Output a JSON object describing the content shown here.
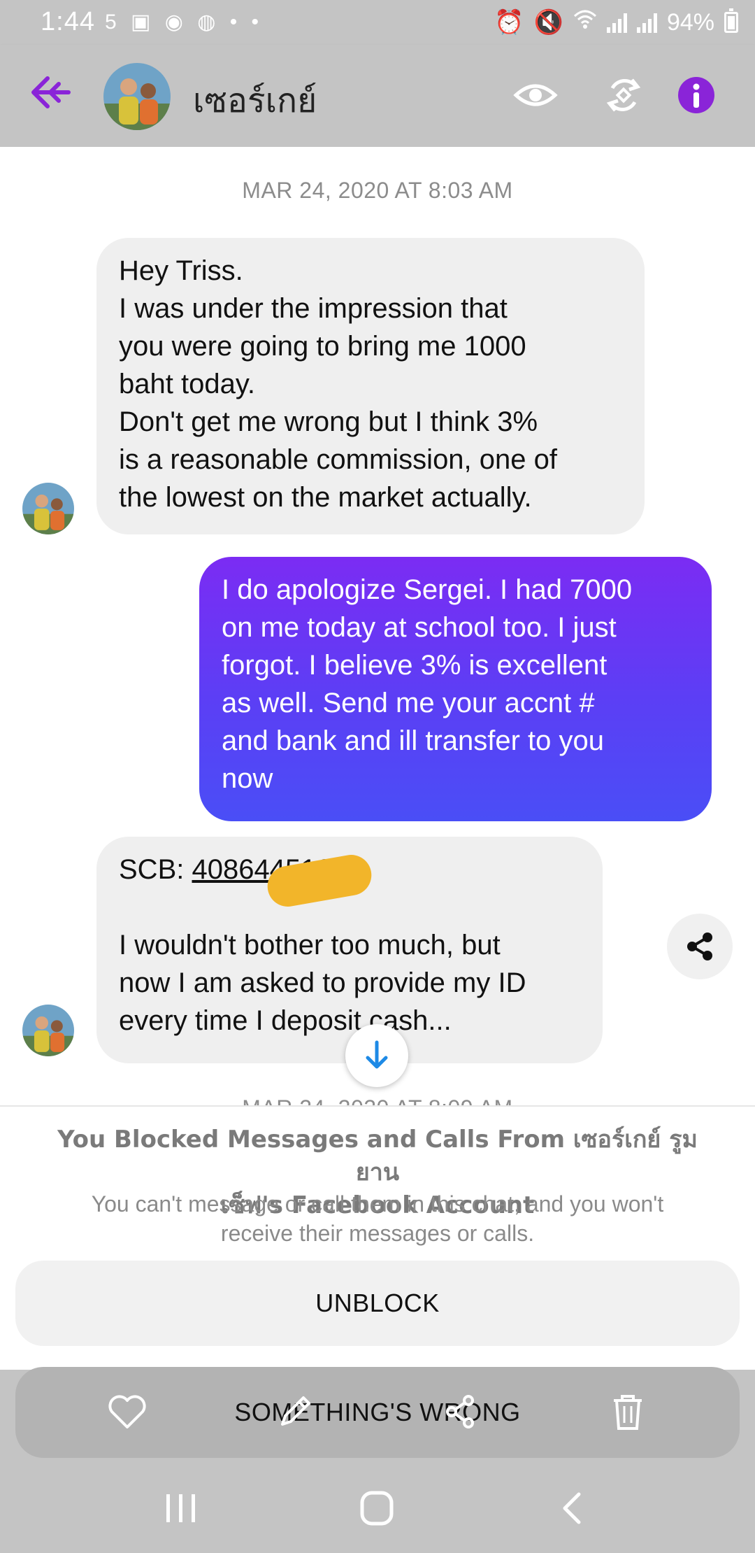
{
  "status_bar": {
    "time": "1:44",
    "battery": "94%",
    "left_icons": "5 ▣ ◉ ◍ • •"
  },
  "header": {
    "contact_name": "เซอร์เกย์"
  },
  "conversation": {
    "timestamp_top": "MAR 24, 2020 AT 8:03 AM",
    "timestamp_bottom": "MAR 24, 2020 AT 8:09 AM",
    "messages": [
      {
        "direction": "incoming",
        "lines": [
          "Hey Triss.",
          "I was under the impression that",
          "you were going to bring me 1000",
          "baht today.",
          "Don't get me wrong but I think 3%",
          "is a reasonable commission, one of",
          "the lowest on the market actually."
        ]
      },
      {
        "direction": "outgoing",
        "lines": [
          "I do apologize Sergei. I had 7000",
          "on me today at school too. I just",
          "forgot. I believe 3% is excellent",
          "as well. Send me your accnt #",
          "and bank and ill transfer to you",
          "now"
        ]
      },
      {
        "direction": "incoming",
        "bank_label": "SCB: ",
        "account_number": "408644516",
        "lines": [
          "I wouldn't bother too much, but",
          "now I am asked to provide my ID",
          "every time I deposit cash..."
        ]
      }
    ]
  },
  "blocked_panel": {
    "title_line1": "You Blocked Messages and Calls From เซอร์เกย์ รูมยาน",
    "title_line2": "เซ็ฟ's Facebook Account",
    "subtitle_line1": "You can't message or call them in this chat, and you won't",
    "subtitle_line2": "receive their messages or calls.",
    "unblock_label": "UNBLOCK",
    "something_wrong_label": "SOMETHING'S WRONG"
  },
  "icons": {
    "back": "double-chevron-left-icon",
    "view": "eye-icon",
    "sync": "sync-icon",
    "info": "info-icon",
    "share": "share-icon",
    "scroll_down": "arrow-down-icon",
    "favorite": "heart-icon",
    "edit": "pencil-icon",
    "share_bottom": "share-icon",
    "delete": "trash-icon"
  },
  "colors": {
    "accent_purple": "#8a24d8",
    "outgoing_bubble_top": "#7b2cf3",
    "outgoing_bubble_bottom": "#4a4ef6",
    "incoming_bubble": "#efefef",
    "overlay_gray": "#c4c4c4",
    "scroll_arrow": "#1e8ae6"
  }
}
